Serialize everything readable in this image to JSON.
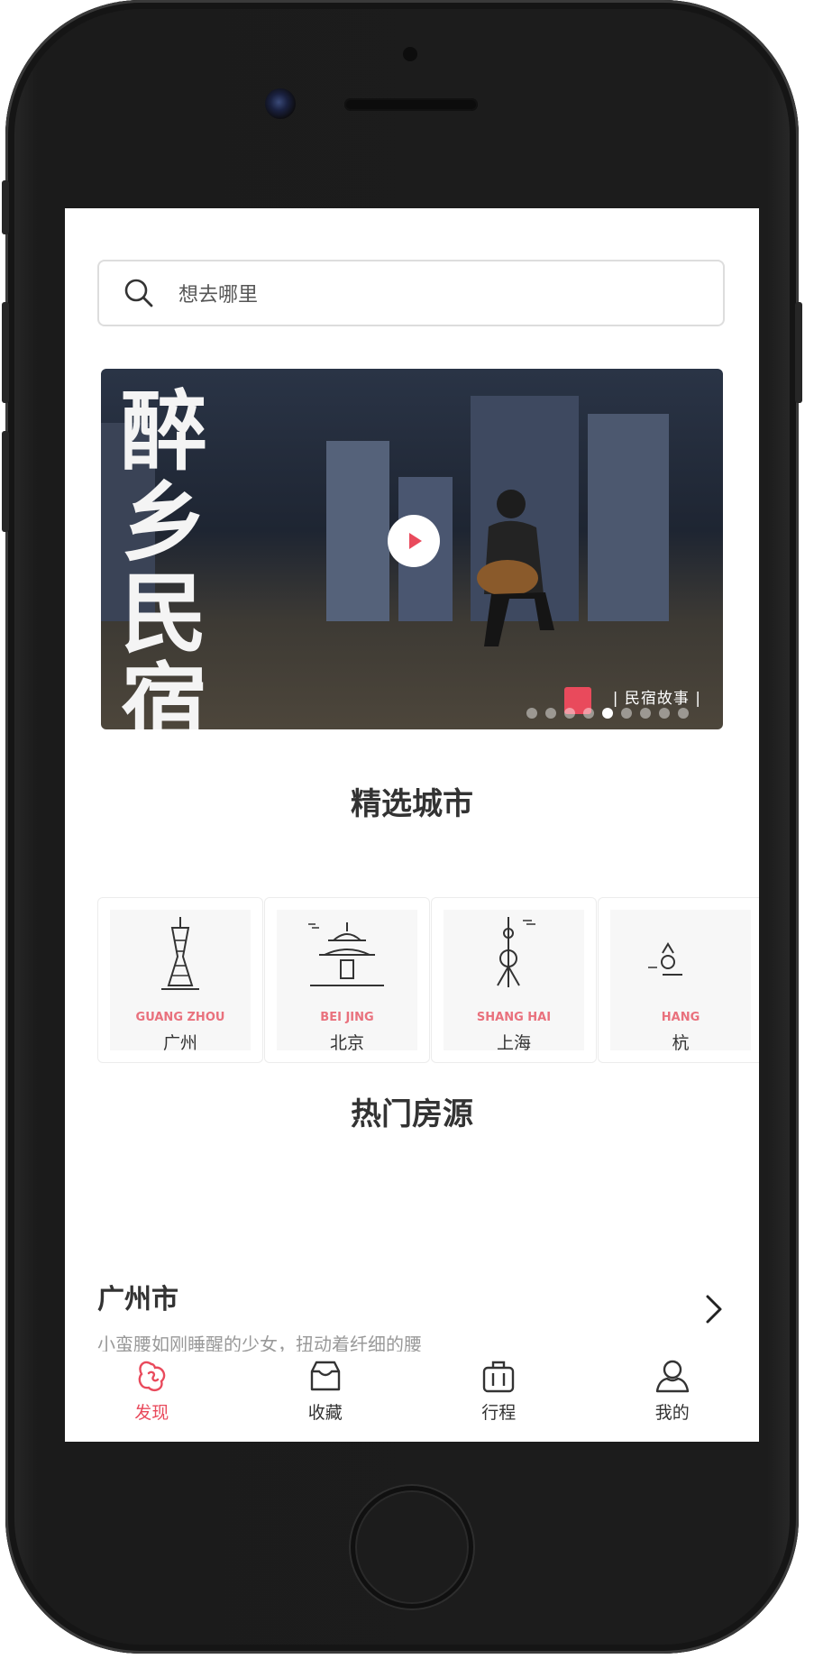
{
  "search": {
    "placeholder": "想去哪里"
  },
  "banner": {
    "headline": "醉乡民宿",
    "caption": "| 民宿故事 |",
    "slide_count": 9,
    "active_slide": 4
  },
  "featured_cities": {
    "title": "精选城市",
    "items": [
      {
        "en": "GUANG ZHOU",
        "cn": "广州",
        "icon": "canton-tower-icon"
      },
      {
        "en": "BEI  JING",
        "cn": "北京",
        "icon": "temple-of-heaven-icon"
      },
      {
        "en": "SHANG  HAI",
        "cn": "上海",
        "icon": "pearl-tower-icon"
      },
      {
        "en": "HANG",
        "cn": "杭",
        "icon": "pagoda-icon"
      }
    ]
  },
  "hot_listings": {
    "title": "热门房源",
    "items": [
      {
        "city": "广州市",
        "description": "小蛮腰如刚睡醒的少女，扭动着纤细的腰"
      }
    ]
  },
  "tabbar": {
    "items": [
      {
        "label": "发现",
        "icon": "discover-icon",
        "active": true
      },
      {
        "label": "收藏",
        "icon": "favorites-icon",
        "active": false
      },
      {
        "label": "行程",
        "icon": "luggage-icon",
        "active": false
      },
      {
        "label": "我的",
        "icon": "profile-icon",
        "active": false
      }
    ]
  },
  "colors": {
    "accent": "#e94a5c",
    "city_en": "#e9717d",
    "text": "#333333",
    "muted": "#999999"
  }
}
